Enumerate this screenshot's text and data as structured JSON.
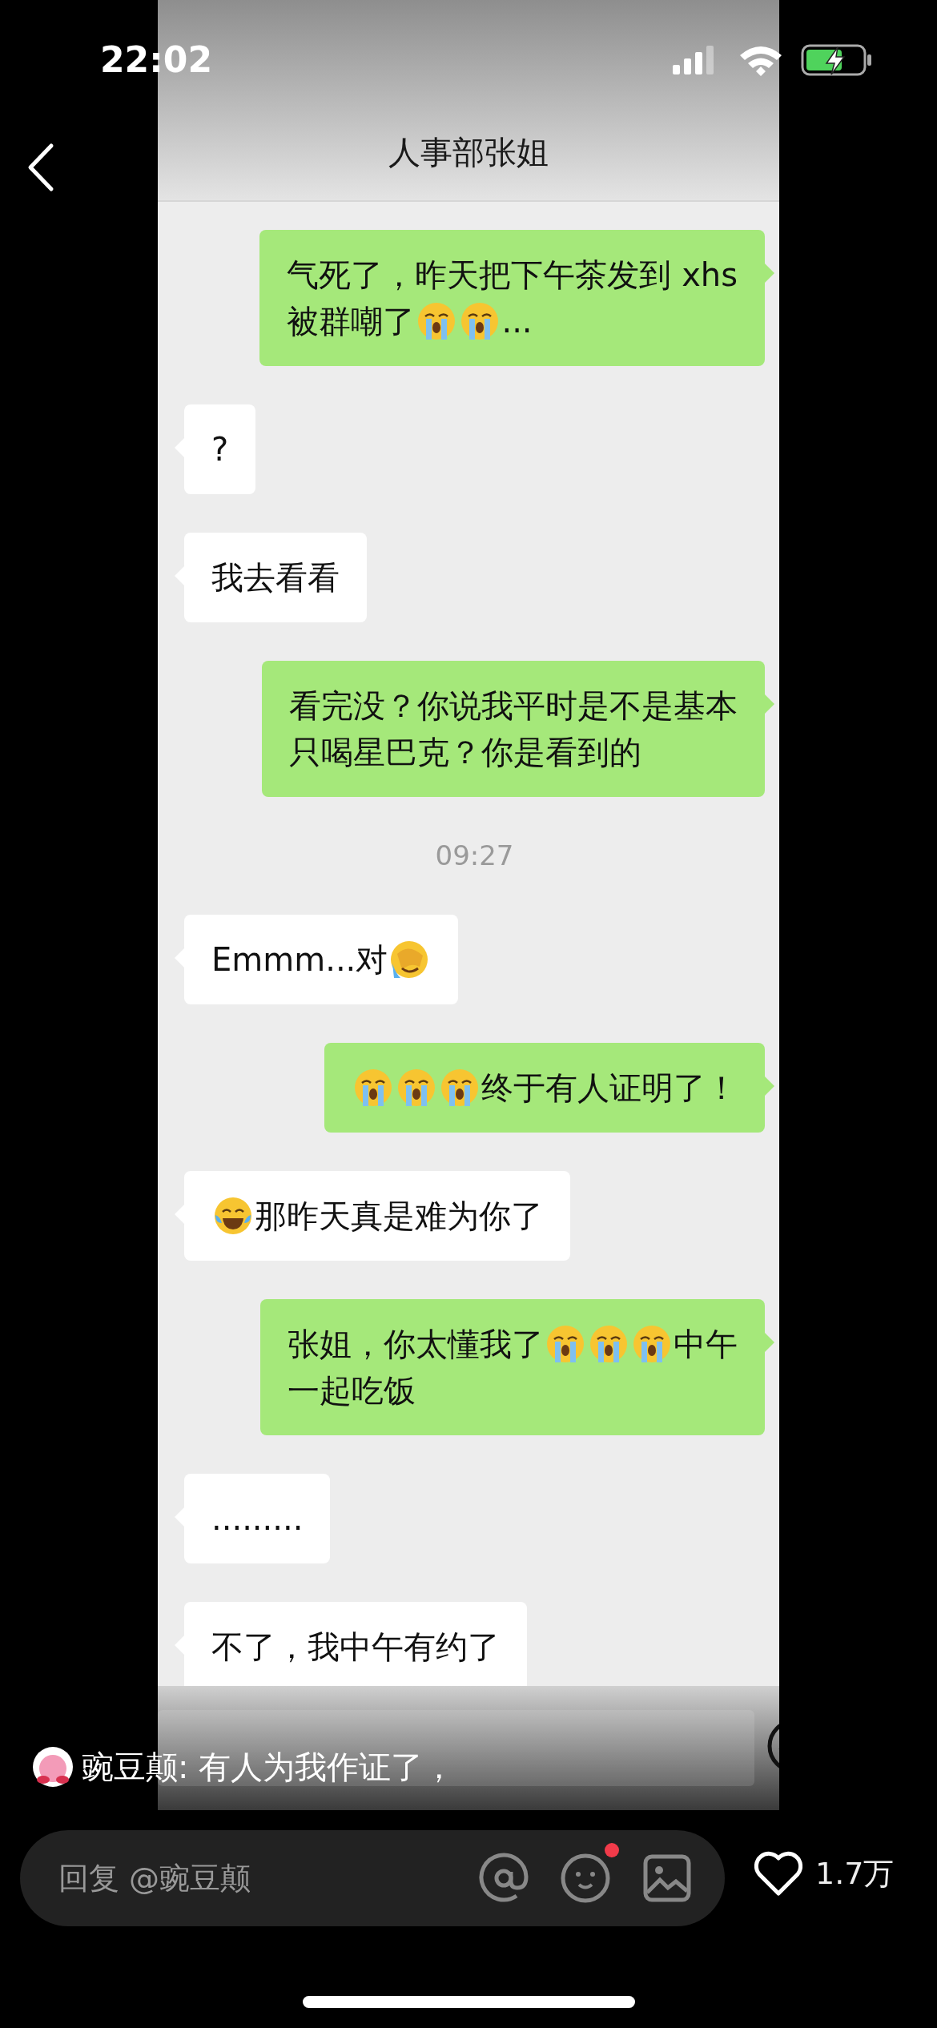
{
  "status_bar": {
    "time": "22:02"
  },
  "chat": {
    "title": "人事部张姐",
    "messages": [
      {
        "kind": "message",
        "outgoing": true,
        "lines": [
          [
            {
              "kind": "text",
              "text": "气死了，昨天把下午茶发到 xhs"
            }
          ],
          [
            {
              "kind": "text",
              "text": "被群嘲了"
            },
            {
              "kind": "crying"
            },
            {
              "kind": "crying"
            },
            {
              "kind": "text",
              "text": "..."
            }
          ]
        ]
      },
      {
        "kind": "message",
        "outgoing": false,
        "lines": [
          [
            {
              "kind": "text",
              "text": "?"
            }
          ]
        ]
      },
      {
        "kind": "message",
        "outgoing": false,
        "lines": [
          [
            {
              "kind": "text",
              "text": "我去看看"
            }
          ]
        ]
      },
      {
        "kind": "message",
        "outgoing": true,
        "lines": [
          [
            {
              "kind": "text",
              "text": "看完没？你说我平时是不是基本"
            }
          ],
          [
            {
              "kind": "text",
              "text": "只喝星巴克？你是看到的"
            }
          ]
        ]
      },
      {
        "kind": "time",
        "text": "09:27"
      },
      {
        "kind": "message",
        "outgoing": false,
        "lines": [
          [
            {
              "kind": "text",
              "text": "Emmm...对"
            },
            {
              "kind": "facepalm"
            }
          ]
        ]
      },
      {
        "kind": "message",
        "outgoing": true,
        "lines": [
          [
            {
              "kind": "crying"
            },
            {
              "kind": "crying"
            },
            {
              "kind": "crying"
            },
            {
              "kind": "text",
              "text": "终于有人证明了！"
            }
          ]
        ]
      },
      {
        "kind": "message",
        "outgoing": false,
        "lines": [
          [
            {
              "kind": "laughing"
            },
            {
              "kind": "text",
              "text": "那昨天真是难为你了"
            }
          ]
        ]
      },
      {
        "kind": "message",
        "outgoing": true,
        "lines": [
          [
            {
              "kind": "text",
              "text": "张姐，你太懂我了"
            },
            {
              "kind": "crying"
            },
            {
              "kind": "crying"
            },
            {
              "kind": "crying"
            },
            {
              "kind": "text",
              "text": "中午"
            }
          ],
          [
            {
              "kind": "text",
              "text": "一起吃饭"
            }
          ]
        ]
      },
      {
        "kind": "message",
        "outgoing": false,
        "lines": [
          [
            {
              "kind": "text",
              "text": "........."
            }
          ]
        ]
      },
      {
        "kind": "message",
        "outgoing": false,
        "lines": [
          [
            {
              "kind": "text",
              "text": "不了，我中午有约了"
            }
          ]
        ]
      }
    ]
  },
  "caption": {
    "text": "豌豆颠: 有人为我作证了，"
  },
  "reply_bar": {
    "placeholder": "回复 @豌豆颠",
    "emoji_badge": true
  },
  "likes": {
    "count": "1.7万"
  }
}
